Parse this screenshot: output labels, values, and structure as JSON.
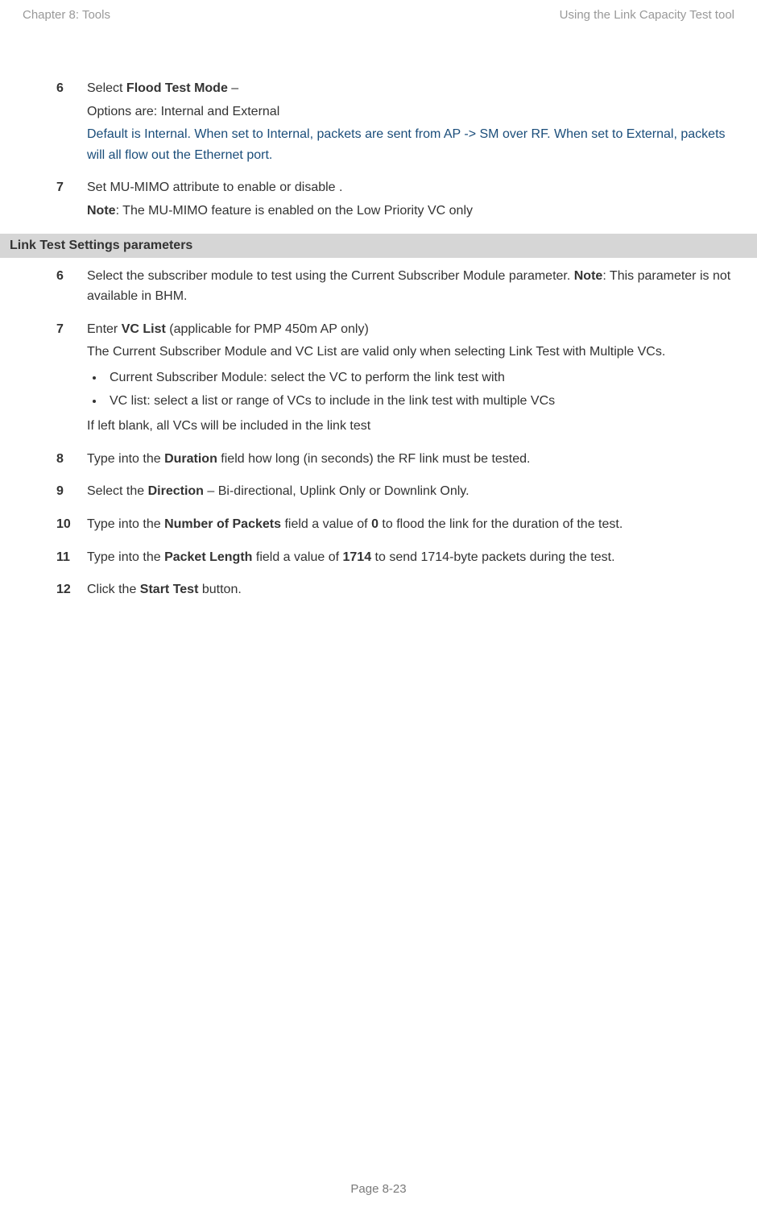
{
  "header": {
    "left": "Chapter 8:  Tools",
    "right": "Using the Link Capacity Test tool"
  },
  "steps_a": [
    {
      "num": "6",
      "lines": [
        {
          "t": "rich",
          "parts": [
            {
              "text": "Select ",
              "b": false
            },
            {
              "text": "Flood Test Mode",
              "b": true
            },
            {
              "text": " – ",
              "b": false
            }
          ]
        },
        {
          "t": "plain",
          "text": "Options are: Internal and External"
        },
        {
          "t": "blue",
          "text": "Default is Internal. When set to Internal, packets are sent from AP -> SM over RF.  When set to External, packets will all flow out the Ethernet port."
        }
      ]
    },
    {
      "num": "7",
      "lines": [
        {
          "t": "plain",
          "text": "Set MU-MIMO attribute to enable or disable ."
        },
        {
          "t": "rich",
          "parts": [
            {
              "text": "Note",
              "b": true
            },
            {
              "text": ": The MU-MIMO feature is enabled on the Low Priority VC only",
              "b": false
            }
          ]
        }
      ]
    }
  ],
  "band": "Link Test Settings parameters",
  "steps_b": [
    {
      "num": "6",
      "lines": [
        {
          "t": "rich",
          "parts": [
            {
              "text": "Select the subscriber module to test using the Current Subscriber Module parameter. ",
              "b": false
            },
            {
              "text": "Note",
              "b": true
            },
            {
              "text": ": This parameter is not available in BHM.",
              "b": false
            }
          ]
        }
      ]
    },
    {
      "num": "7",
      "lines": [
        {
          "t": "rich",
          "parts": [
            {
              "text": "Enter ",
              "b": false
            },
            {
              "text": "VC List",
              "b": true
            },
            {
              "text": " (applicable for PMP 450m AP only)",
              "b": false
            }
          ]
        },
        {
          "t": "plain",
          "text": "The Current Subscriber Module and VC List are valid only when selecting Link Test with Multiple VCs."
        },
        {
          "t": "bullets",
          "items": [
            "Current Subscriber Module: select the VC to perform the link test with",
            "VC list: select a list or range of VCs to include in the link test with multiple VCs"
          ],
          "trailing": "If left blank, all VCs will be included in the link test"
        }
      ]
    },
    {
      "num": "8",
      "lines": [
        {
          "t": "rich",
          "parts": [
            {
              "text": "Type into the ",
              "b": false
            },
            {
              "text": "Duration",
              "b": true
            },
            {
              "text": " field how long (in seconds) the RF link must be tested.",
              "b": false
            }
          ]
        }
      ]
    },
    {
      "num": "9",
      "lines": [
        {
          "t": "rich",
          "parts": [
            {
              "text": "Select the ",
              "b": false
            },
            {
              "text": "Direction",
              "b": true
            },
            {
              "text": " – Bi-directional, Uplink Only or Downlink Only.",
              "b": false
            }
          ]
        }
      ]
    },
    {
      "num": "10",
      "lines": [
        {
          "t": "rich",
          "parts": [
            {
              "text": "Type into the ",
              "b": false
            },
            {
              "text": "Number of Packets",
              "b": true
            },
            {
              "text": " field a value of ",
              "b": false
            },
            {
              "text": "0",
              "b": true
            },
            {
              "text": " to flood the link for the duration of the test.",
              "b": false
            }
          ]
        }
      ]
    },
    {
      "num": "11",
      "lines": [
        {
          "t": "rich",
          "parts": [
            {
              "text": "Type into the ",
              "b": false
            },
            {
              "text": "Packet Length",
              "b": true
            },
            {
              "text": " field a value of ",
              "b": false
            },
            {
              "text": "1714",
              "b": true
            },
            {
              "text": " to send 1714-byte packets during the test.",
              "b": false
            }
          ]
        }
      ]
    },
    {
      "num": "12",
      "lines": [
        {
          "t": "rich",
          "parts": [
            {
              "text": "Click the ",
              "b": false
            },
            {
              "text": "Start Test",
              "b": true
            },
            {
              "text": " button.",
              "b": false
            }
          ]
        }
      ]
    }
  ],
  "footer": "Page 8-23"
}
